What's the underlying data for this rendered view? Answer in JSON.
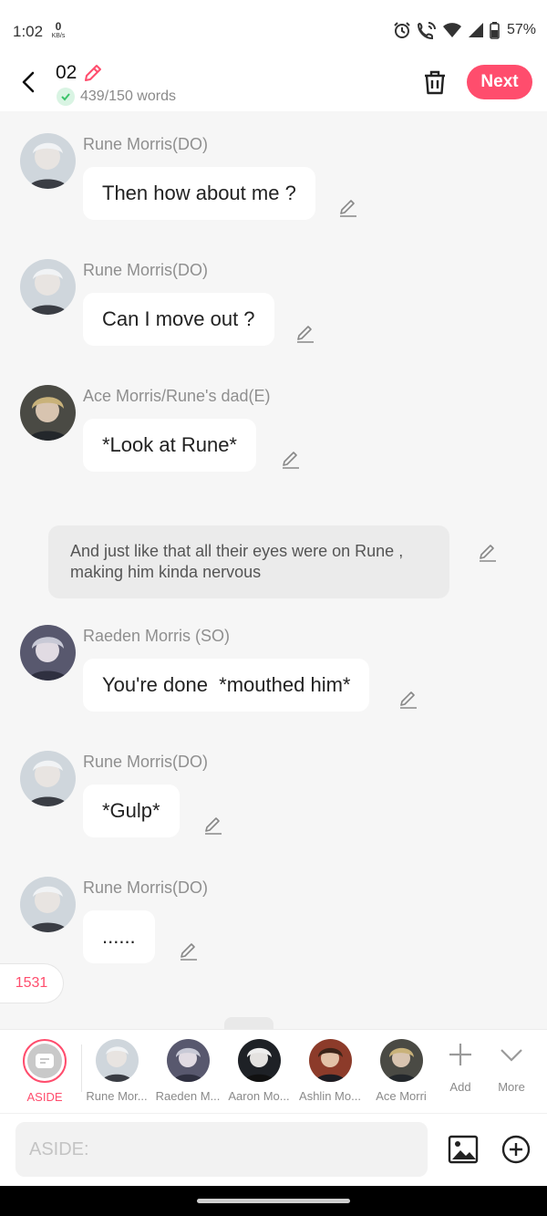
{
  "status_bar": {
    "time": "1:02",
    "net_speed_value": "0",
    "net_speed_unit": "KB/s",
    "battery": "57%"
  },
  "header": {
    "title": "02",
    "word_count": "439/150 words",
    "next_label": "Next"
  },
  "messages": [
    {
      "type": "dialog",
      "speaker": "Rune Morris(DO)",
      "text": "Then how about me ?"
    },
    {
      "type": "dialog",
      "speaker": "Rune Morris(DO)",
      "text": "Can I move out ?"
    },
    {
      "type": "dialog",
      "speaker": "Ace Morris/Rune's dad(E)",
      "text": "*Look at Rune*"
    },
    {
      "type": "aside",
      "text": "And just like that all their eyes were on Rune , making him kinda nervous"
    },
    {
      "type": "dialog",
      "speaker": "Raeden Morris (SO)",
      "text": "You're done  *mouthed him*"
    },
    {
      "type": "dialog",
      "speaker": "Rune Morris(DO)",
      "text": "*Gulp*"
    },
    {
      "type": "dialog",
      "speaker": "Rune Morris(DO)",
      "text": "......"
    }
  ],
  "floating_count": "1531",
  "character_bar": {
    "aside_label": "ASIDE",
    "characters": [
      {
        "label": "Rune Mor..."
      },
      {
        "label": "Raeden M..."
      },
      {
        "label": "Aaron Mo..."
      },
      {
        "label": "Ashlin Mo..."
      },
      {
        "label": "Ace Morri"
      }
    ],
    "add_label": "Add",
    "more_label": "More"
  },
  "input": {
    "placeholder": "ASIDE:"
  },
  "colors": {
    "accent": "#ff4d6d",
    "background": "#f6f6f6"
  }
}
